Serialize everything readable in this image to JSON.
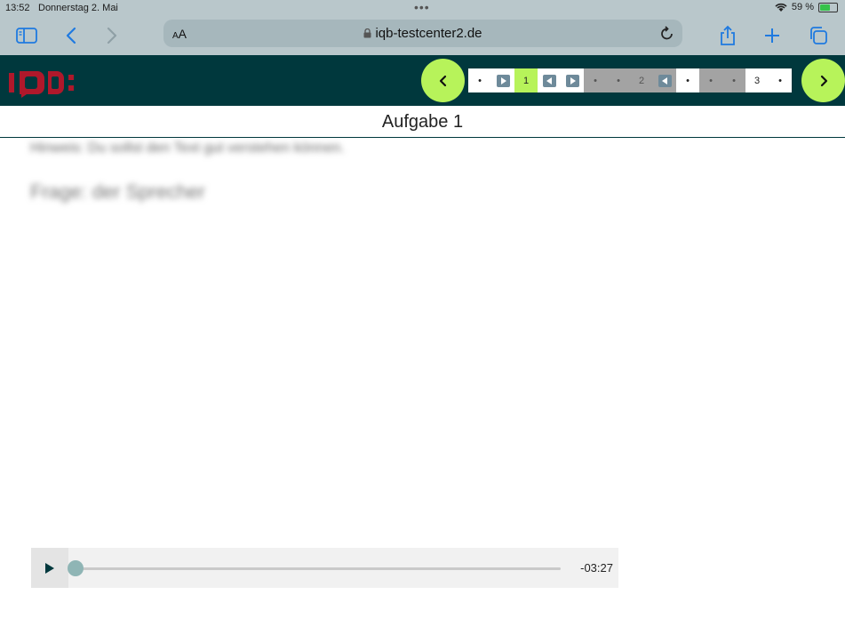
{
  "status": {
    "time": "13:52",
    "date": "Donnerstag 2. Mai",
    "battery": "59 %",
    "battery_level": 0.59
  },
  "browser": {
    "aa_small": "A",
    "aa_big": "A",
    "url": "iqb-testcenter2.de"
  },
  "nav": {
    "units": [
      {
        "type": "dot",
        "label": "•",
        "state": "white"
      },
      {
        "type": "icon",
        "icon": "play-forward-icon",
        "state": "white"
      },
      {
        "type": "num",
        "label": "1",
        "state": "active"
      },
      {
        "type": "icon",
        "icon": "play-back-icon",
        "state": "white"
      },
      {
        "type": "icon",
        "icon": "play-forward-icon",
        "state": "white"
      },
      {
        "type": "dot",
        "label": "•",
        "state": "gray"
      },
      {
        "type": "dot",
        "label": "•",
        "state": "gray"
      },
      {
        "type": "num",
        "label": "2",
        "state": "gray"
      },
      {
        "type": "icon",
        "icon": "play-back-icon",
        "state": "gray"
      },
      {
        "type": "dot",
        "label": "•",
        "state": "white"
      },
      {
        "type": "dot",
        "label": "•",
        "state": "gray"
      },
      {
        "type": "dot",
        "label": "•",
        "state": "gray"
      },
      {
        "type": "num",
        "label": "3",
        "state": "white"
      },
      {
        "type": "dot",
        "label": "•",
        "state": "white"
      }
    ]
  },
  "page": {
    "title": "Aufgabe 1",
    "blurred_line1": "Hinweis: Du sollst den Text gut verstehen können.",
    "blurred_line2": "Frage: der Sprecher"
  },
  "player": {
    "time": "-03:27",
    "progress": 0.0
  },
  "colors": {
    "header": "#00383d",
    "accent": "#b7f35a",
    "browser_chrome": "#b9c7cb"
  }
}
